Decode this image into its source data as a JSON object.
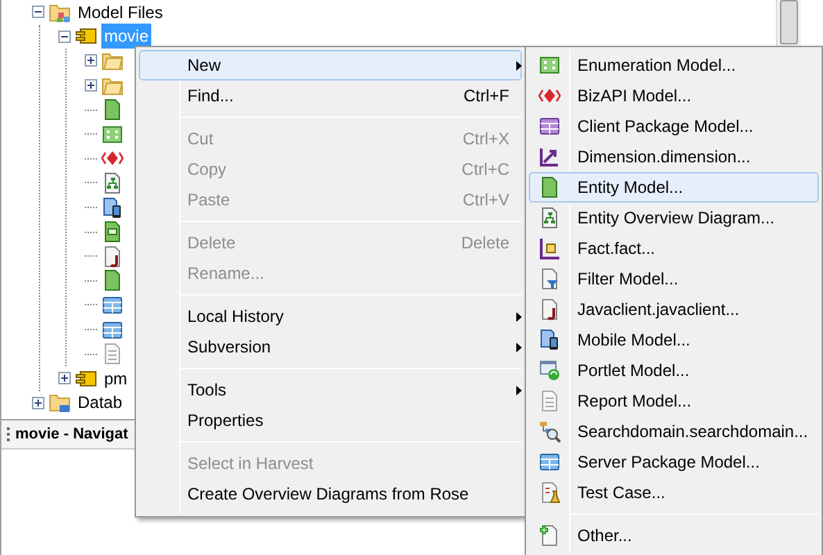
{
  "tree": [
    {
      "label": "Model Files",
      "kind": "folder-model",
      "expanded": true,
      "selected": false,
      "children": [
        {
          "label": "movie",
          "kind": "package",
          "expanded": true,
          "selected": true,
          "children": [
            {
              "kind": "folder",
              "expanded": false,
              "selected": false
            },
            {
              "kind": "folder",
              "expanded": false,
              "selected": false
            },
            {
              "kind": "entity",
              "selected": false
            },
            {
              "kind": "enum",
              "selected": false
            },
            {
              "kind": "bizapi",
              "selected": false
            },
            {
              "kind": "diagram",
              "selected": false
            },
            {
              "kind": "mobile",
              "selected": false
            },
            {
              "kind": "fact-doc",
              "selected": false
            },
            {
              "kind": "javaclient",
              "selected": false
            },
            {
              "kind": "entity",
              "selected": false
            },
            {
              "kind": "serverpkg",
              "selected": false
            },
            {
              "kind": "serverpkg",
              "selected": false
            },
            {
              "kind": "report",
              "selected": false
            }
          ]
        },
        {
          "label": "pm",
          "kind": "package",
          "expanded": false,
          "selected": false
        }
      ]
    },
    {
      "label": "Datab",
      "kind": "folder-db",
      "expanded": false,
      "selected": false
    }
  ],
  "navigator": {
    "title": "movie - Navigat"
  },
  "context_menu": {
    "groups": [
      [
        {
          "label": "New",
          "submenu": true,
          "disabled": false,
          "selected": true
        },
        {
          "label": "Find...",
          "shortcut": "Ctrl+F",
          "submenu": false,
          "disabled": false,
          "selected": false
        }
      ],
      [
        {
          "label": "Cut",
          "shortcut": "Ctrl+X",
          "submenu": false,
          "disabled": true,
          "selected": false
        },
        {
          "label": "Copy",
          "shortcut": "Ctrl+C",
          "submenu": false,
          "disabled": true,
          "selected": false
        },
        {
          "label": "Paste",
          "shortcut": "Ctrl+V",
          "submenu": false,
          "disabled": true,
          "selected": false
        }
      ],
      [
        {
          "label": "Delete",
          "shortcut": "Delete",
          "submenu": false,
          "disabled": true,
          "selected": false
        },
        {
          "label": "Rename...",
          "submenu": false,
          "disabled": true,
          "selected": false
        }
      ],
      [
        {
          "label": "Local History",
          "submenu": true,
          "disabled": false,
          "selected": false
        },
        {
          "label": "Subversion",
          "submenu": true,
          "disabled": false,
          "selected": false
        }
      ],
      [
        {
          "label": "Tools",
          "submenu": true,
          "disabled": false,
          "selected": false
        },
        {
          "label": "Properties",
          "submenu": false,
          "disabled": false,
          "selected": false
        }
      ],
      [
        {
          "label": "Select in Harvest",
          "submenu": false,
          "disabled": true,
          "selected": false
        },
        {
          "label": "Create Overview Diagrams from Rose",
          "submenu": false,
          "disabled": false,
          "selected": false
        }
      ]
    ]
  },
  "submenu": {
    "groups": [
      [
        {
          "label": "Enumeration Model...",
          "kind": "enum",
          "selected": false
        },
        {
          "label": "BizAPI Model...",
          "kind": "bizapi",
          "selected": false
        },
        {
          "label": "Client Package Model...",
          "kind": "clientpkg",
          "selected": false
        },
        {
          "label": "Dimension.dimension...",
          "kind": "dimension",
          "selected": false
        },
        {
          "label": "Entity Model...",
          "kind": "entity",
          "selected": true
        },
        {
          "label": "Entity Overview Diagram...",
          "kind": "diagram",
          "selected": false
        },
        {
          "label": "Fact.fact...",
          "kind": "fact",
          "selected": false
        },
        {
          "label": "Filter Model...",
          "kind": "filter",
          "selected": false
        },
        {
          "label": "Javaclient.javaclient...",
          "kind": "javaclient",
          "selected": false
        },
        {
          "label": "Mobile Model...",
          "kind": "mobile",
          "selected": false
        },
        {
          "label": "Portlet Model...",
          "kind": "portlet",
          "selected": false
        },
        {
          "label": "Report Model...",
          "kind": "report",
          "selected": false
        },
        {
          "label": "Searchdomain.searchdomain...",
          "kind": "search",
          "selected": false
        },
        {
          "label": "Server Package Model...",
          "kind": "serverpkg",
          "selected": false
        },
        {
          "label": "Test Case...",
          "kind": "testcase",
          "selected": false
        }
      ],
      [
        {
          "label": "Other...",
          "kind": "other",
          "selected": false
        }
      ]
    ]
  }
}
